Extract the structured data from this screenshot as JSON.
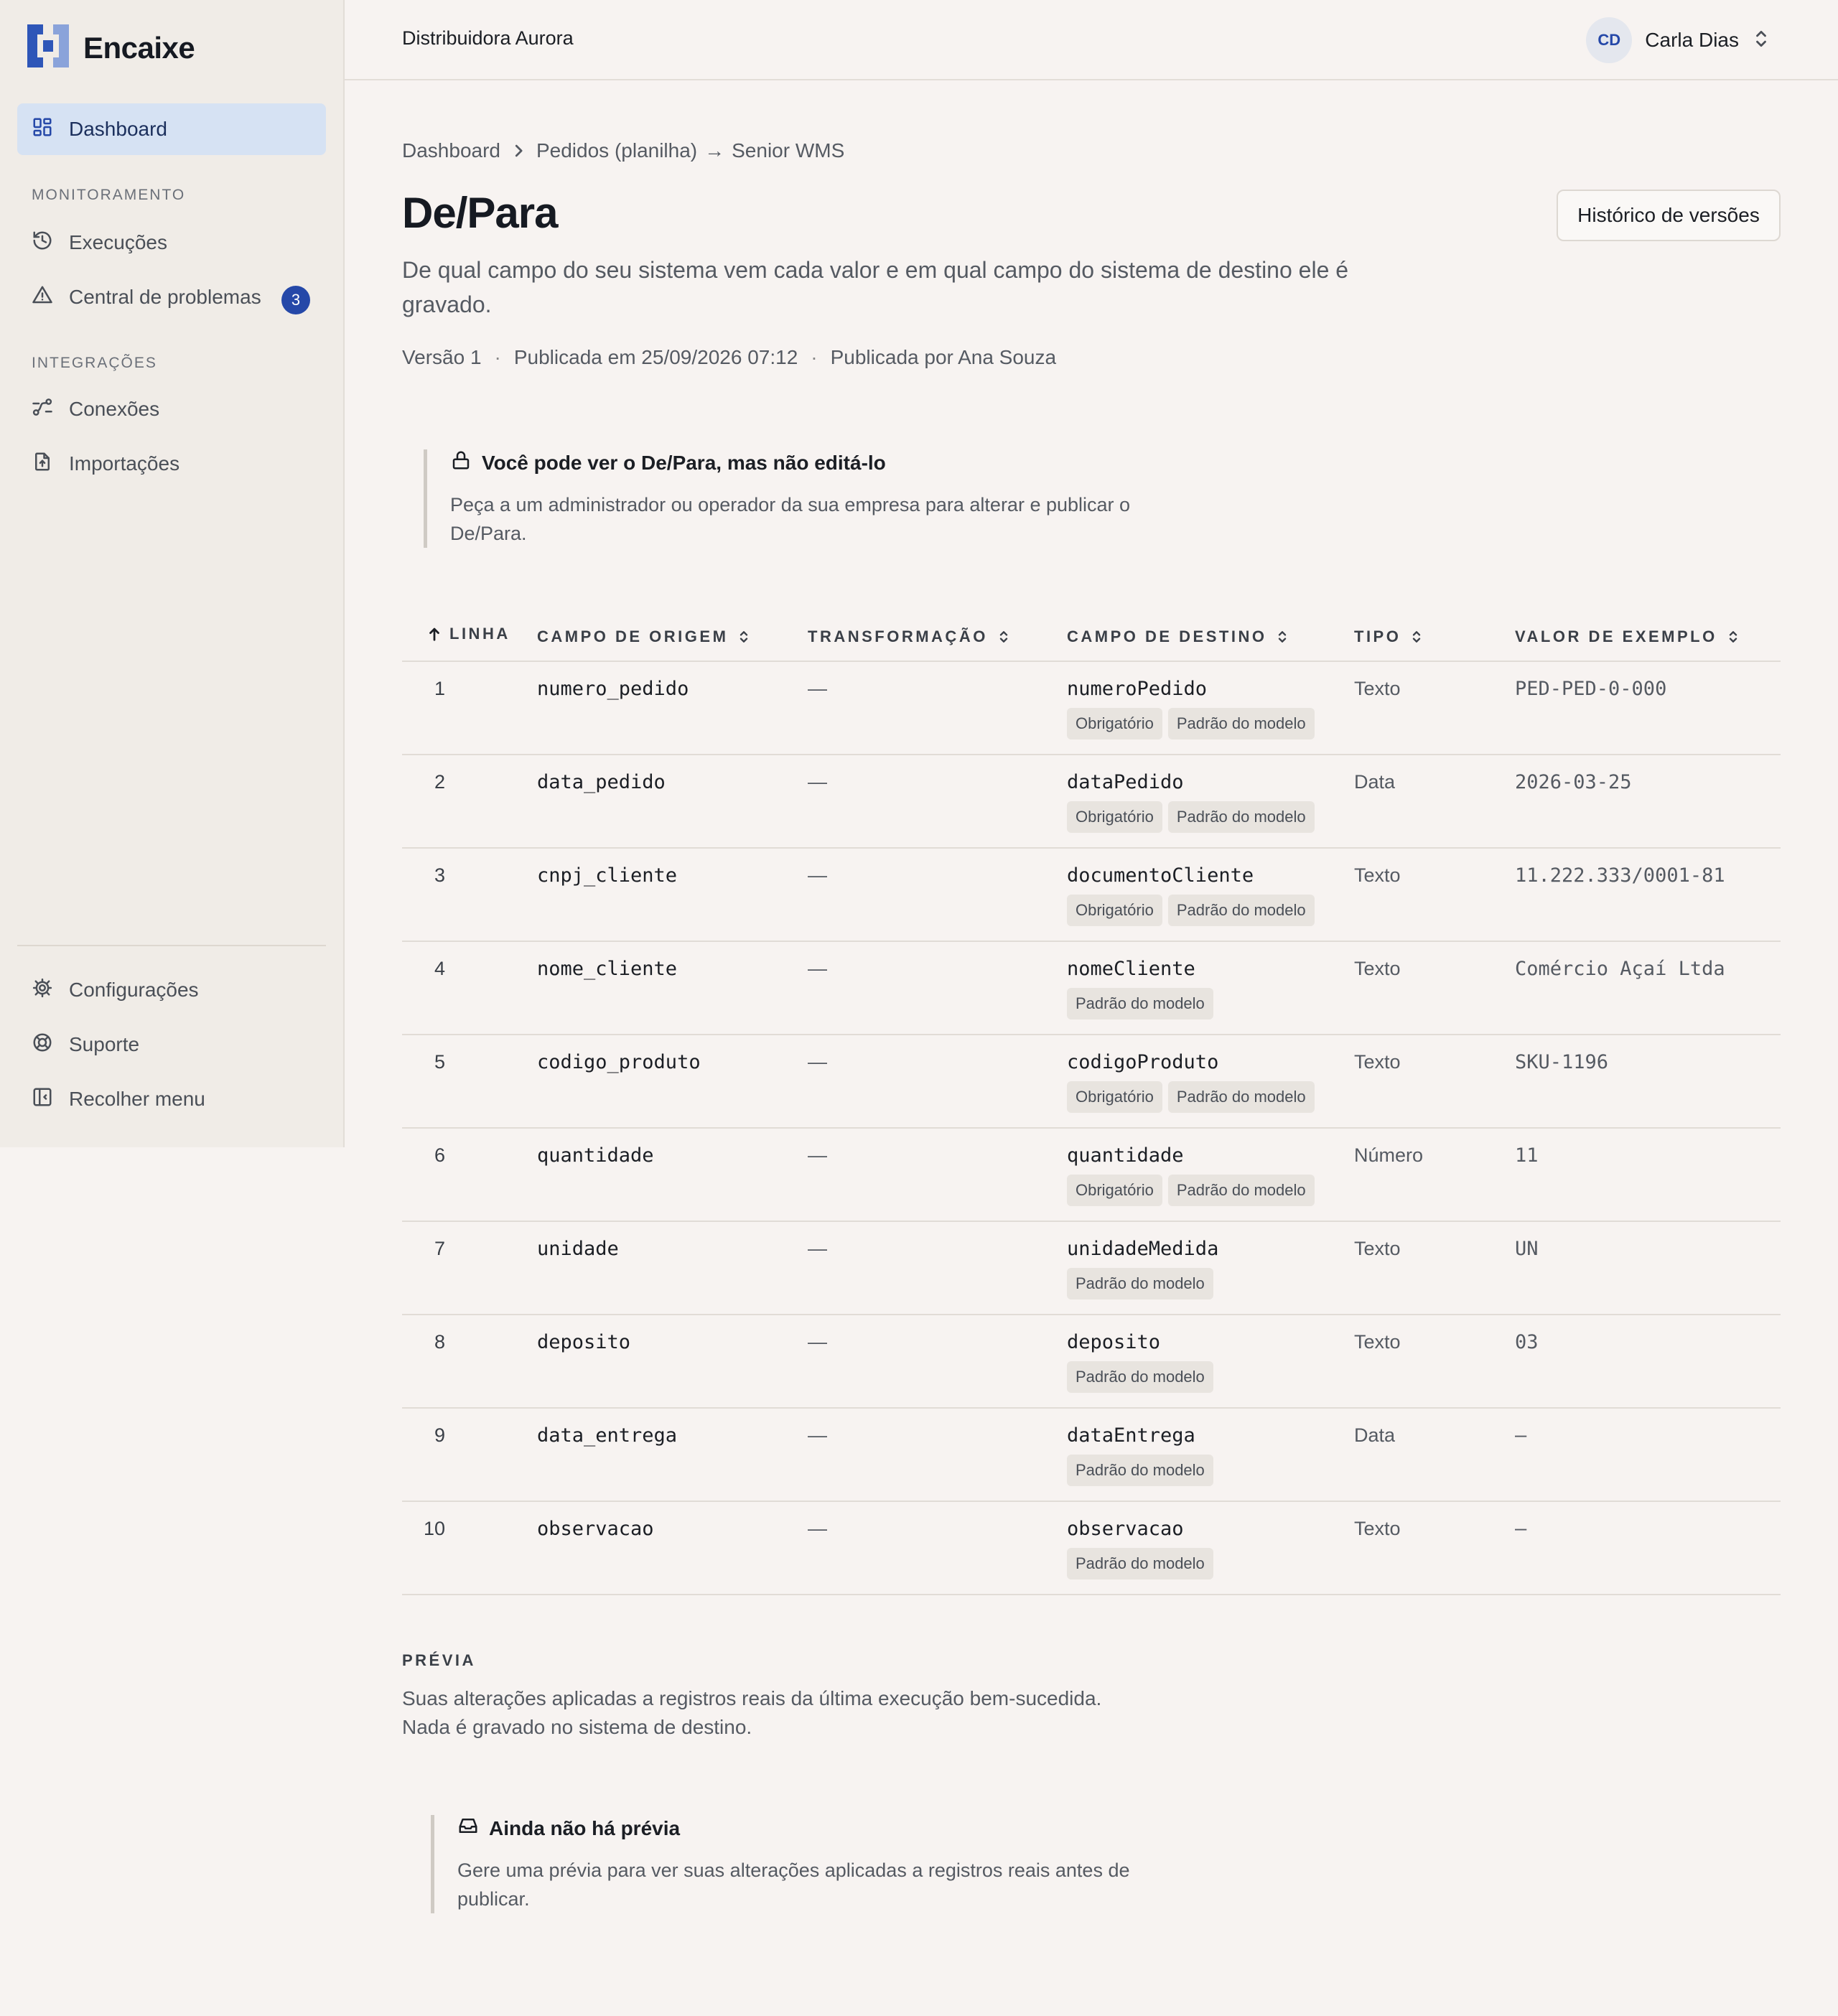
{
  "app": {
    "name": "Encaixe",
    "organization": "Distribuidora Aurora",
    "user": {
      "initials": "CD",
      "name": "Carla Dias"
    }
  },
  "sidebar": {
    "dashboard": "Dashboard",
    "section_monitoring": "MONITORAMENTO",
    "executions": "Execuções",
    "problems": "Central de problemas",
    "problems_count": "3",
    "section_integrations": "INTEGRAÇÕES",
    "connections": "Conexões",
    "imports": "Importações",
    "settings": "Configurações",
    "support": "Suporte",
    "collapse": "Recolher menu"
  },
  "breadcrumb": {
    "root": "Dashboard",
    "source": "Pedidos (planilha)",
    "arrow": "→",
    "target": "Senior WMS"
  },
  "page": {
    "title": "De/Para",
    "history_button": "Histórico de versões",
    "description": "De qual campo do seu sistema vem cada valor e em qual campo do sistema de destino ele é gravado.",
    "version": "Versão 1",
    "published_at": "Publicada em 25/09/2026 07:12",
    "published_by": "Publicada por Ana Souza",
    "separator": "·"
  },
  "readonly_notice": {
    "title": "Você pode ver o De/Para, mas não editá-lo",
    "body": "Peça a um administrador ou operador da sua empresa para alterar e publicar o De/Para."
  },
  "table": {
    "columns": {
      "line": "LINHA",
      "source": "CAMPO DE ORIGEM",
      "transform": "TRANSFORMAÇÃO",
      "target": "CAMPO DE DESTINO",
      "type": "TIPO",
      "example": "VALOR DE EXEMPLO"
    },
    "rows": [
      {
        "line": "1",
        "source": "numero_pedido",
        "transform": "—",
        "target": "numeroPedido",
        "tags": [
          "Obrigatório",
          "Padrão do modelo"
        ],
        "type": "Texto",
        "example": "PED-PED-0-000"
      },
      {
        "line": "2",
        "source": "data_pedido",
        "transform": "—",
        "target": "dataPedido",
        "tags": [
          "Obrigatório",
          "Padrão do modelo"
        ],
        "type": "Data",
        "example": "2026-03-25"
      },
      {
        "line": "3",
        "source": "cnpj_cliente",
        "transform": "—",
        "target": "documentoCliente",
        "tags": [
          "Obrigatório",
          "Padrão do modelo"
        ],
        "type": "Texto",
        "example": "11.222.333/0001-81"
      },
      {
        "line": "4",
        "source": "nome_cliente",
        "transform": "—",
        "target": "nomeCliente",
        "tags": [
          "Padrão do modelo"
        ],
        "type": "Texto",
        "example": "Comércio Açaí Ltda"
      },
      {
        "line": "5",
        "source": "codigo_produto",
        "transform": "—",
        "target": "codigoProduto",
        "tags": [
          "Obrigatório",
          "Padrão do modelo"
        ],
        "type": "Texto",
        "example": "SKU-1196"
      },
      {
        "line": "6",
        "source": "quantidade",
        "transform": "—",
        "target": "quantidade",
        "tags": [
          "Obrigatório",
          "Padrão do modelo"
        ],
        "type": "Número",
        "example": "11"
      },
      {
        "line": "7",
        "source": "unidade",
        "transform": "—",
        "target": "unidadeMedida",
        "tags": [
          "Padrão do modelo"
        ],
        "type": "Texto",
        "example": "UN"
      },
      {
        "line": "8",
        "source": "deposito",
        "transform": "—",
        "target": "deposito",
        "tags": [
          "Padrão do modelo"
        ],
        "type": "Texto",
        "example": "03"
      },
      {
        "line": "9",
        "source": "data_entrega",
        "transform": "—",
        "target": "dataEntrega",
        "tags": [
          "Padrão do modelo"
        ],
        "type": "Data",
        "example": "—"
      },
      {
        "line": "10",
        "source": "observacao",
        "transform": "—",
        "target": "observacao",
        "tags": [
          "Padrão do modelo"
        ],
        "type": "Texto",
        "example": "—"
      }
    ]
  },
  "preview": {
    "label": "PRÉVIA",
    "line1": "Suas alterações aplicadas a registros reais da última execução bem-sucedida.",
    "line2": "Nada é gravado no sistema de destino.",
    "empty_title": "Ainda não há prévia",
    "empty_body": "Gere uma prévia para ver suas alterações aplicadas a registros reais antes de publicar."
  },
  "colors": {
    "accent": "#2548a8",
    "active_nav_bg": "#d6e2f3",
    "background": "#f7f3f1",
    "sidebar_bg": "#f0ece7"
  }
}
